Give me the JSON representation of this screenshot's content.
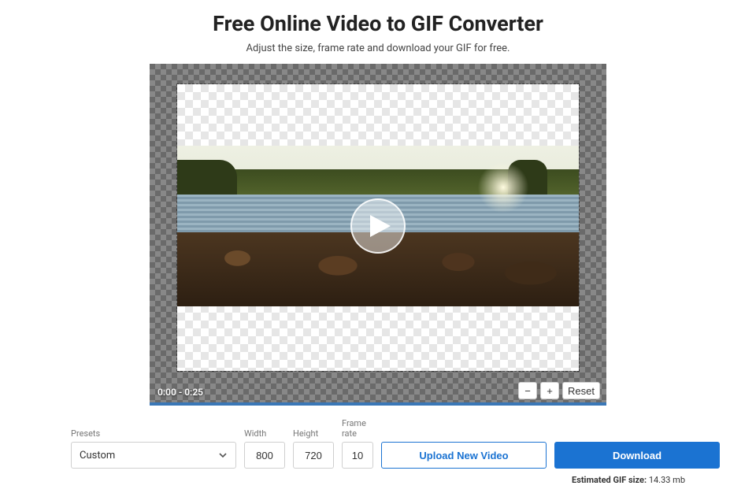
{
  "header": {
    "title": "Free Online Video to GIF Converter",
    "subtitle": "Adjust the size, frame rate and download your GIF for free."
  },
  "stage": {
    "time_range": "0:00 - 0:25",
    "zoom_out_label": "−",
    "zoom_in_label": "+",
    "reset_label": "Reset"
  },
  "controls": {
    "presets_label": "Presets",
    "presets_value": "Custom",
    "width_label": "Width",
    "width_value": "800",
    "height_label": "Height",
    "height_value": "720",
    "framerate_label": "Frame rate",
    "framerate_value": "10",
    "upload_label": "Upload New Video",
    "download_label": "Download"
  },
  "footer": {
    "estimate_label": "Estimated GIF size:",
    "estimate_value": "14.33 mb"
  }
}
